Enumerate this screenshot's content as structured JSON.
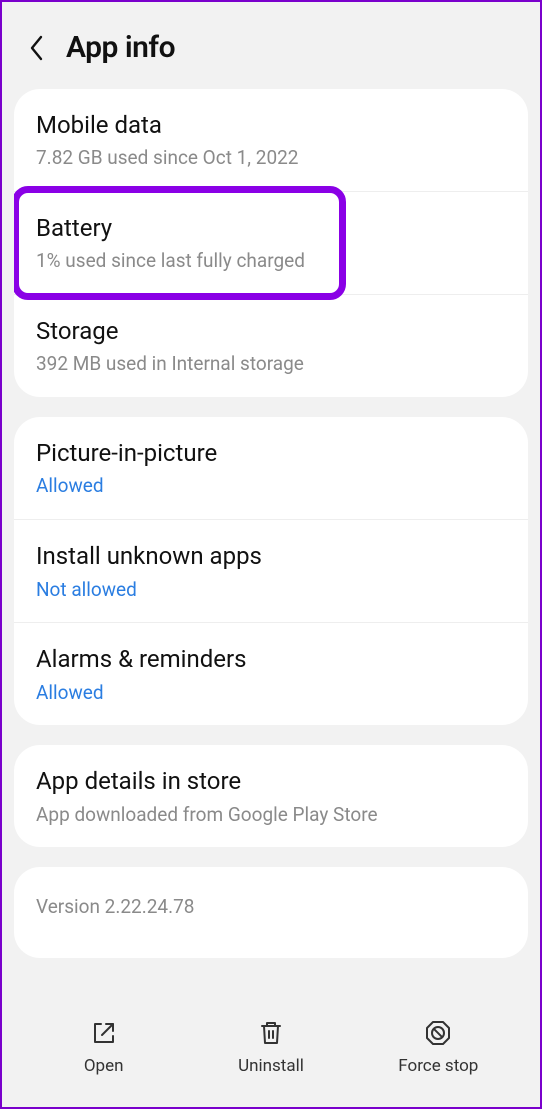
{
  "header": {
    "title": "App info"
  },
  "card_usage": {
    "mobile_data": {
      "title": "Mobile data",
      "sub": "7.82 GB used since Oct 1, 2022"
    },
    "battery": {
      "title": "Battery",
      "sub": "1% used since last fully charged"
    },
    "storage": {
      "title": "Storage",
      "sub": "392 MB used in Internal storage"
    }
  },
  "card_permissions": {
    "pip": {
      "title": "Picture-in-picture",
      "status": "Allowed"
    },
    "unknown": {
      "title": "Install unknown apps",
      "status": "Not allowed"
    },
    "alarms": {
      "title": "Alarms & reminders",
      "status": "Allowed"
    }
  },
  "card_store": {
    "title": "App details in store",
    "sub": "App downloaded from Google Play Store"
  },
  "version": "Version 2.22.24.78",
  "bottom": {
    "open": "Open",
    "uninstall": "Uninstall",
    "force_stop": "Force stop"
  }
}
